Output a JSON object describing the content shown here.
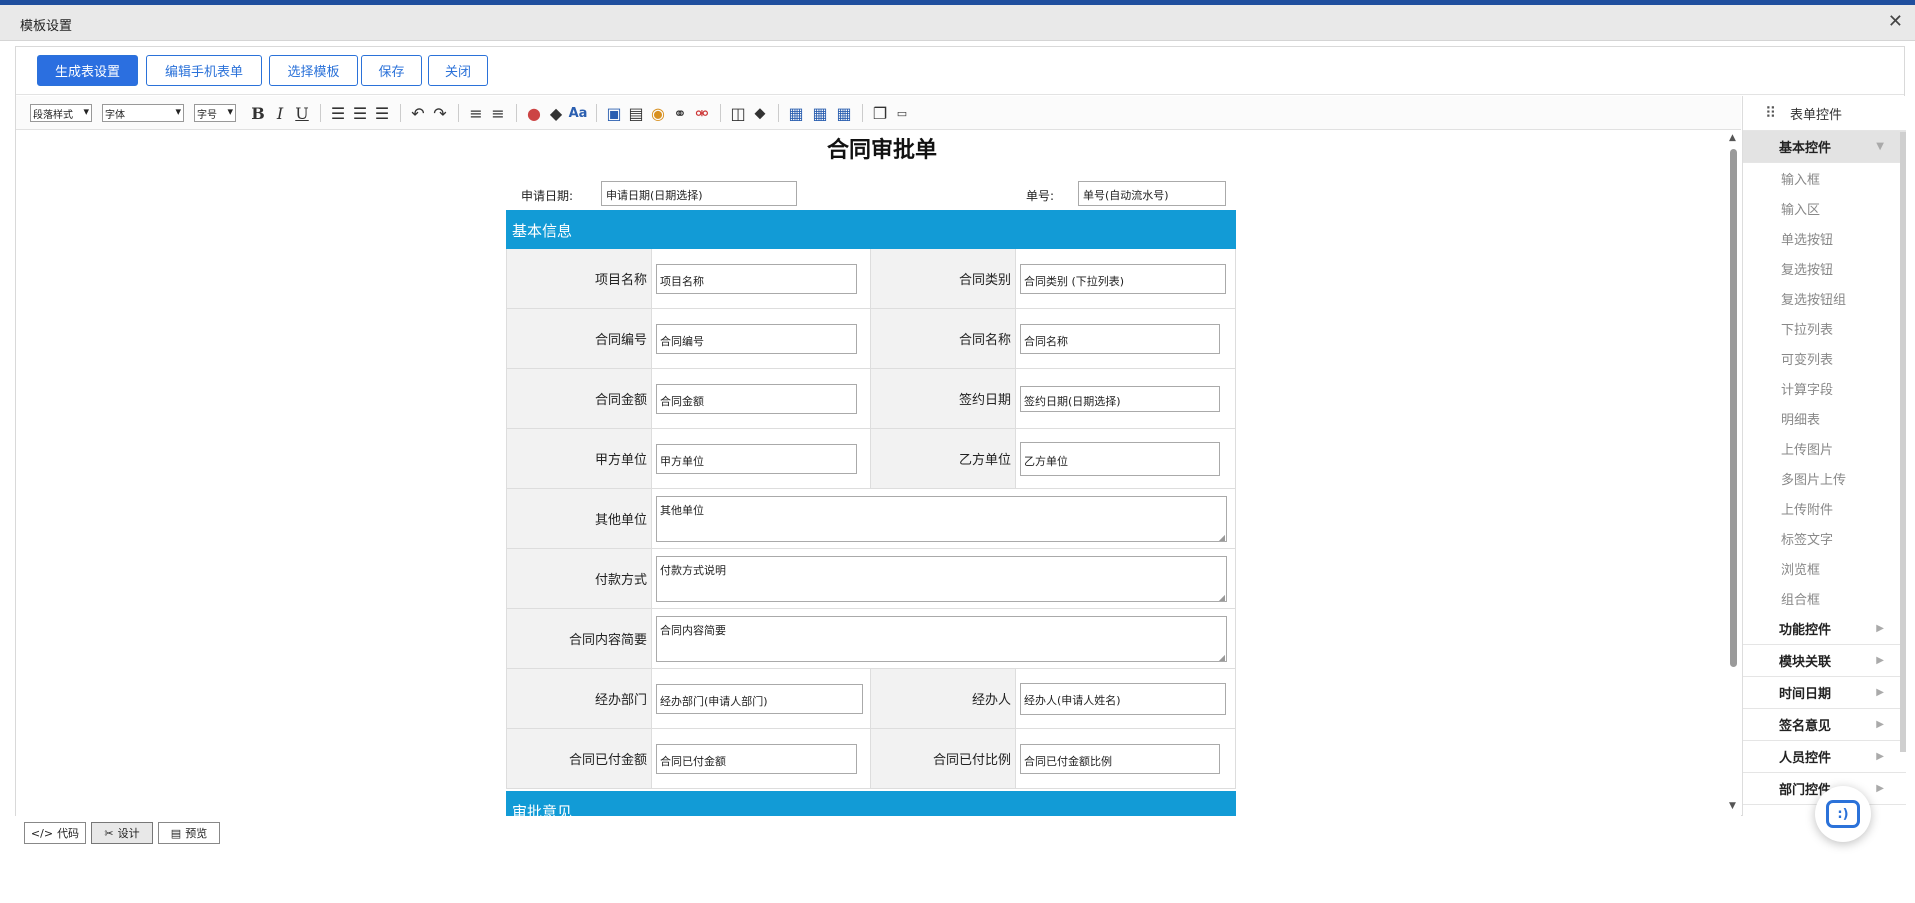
{
  "window": {
    "title": "模板设置",
    "close_glyph": "✕"
  },
  "buttons": {
    "generate": "生成表设置",
    "edit_mobile": "编辑手机表单",
    "select_template": "选择模板",
    "save": "保存",
    "close": "关闭"
  },
  "toolbar": {
    "paragraph_style": "段落样式",
    "font": "字体",
    "font_size": "字号"
  },
  "form": {
    "title": "合同审批单",
    "apply_date_label": "申请日期:",
    "apply_date_value": "申请日期(日期选择)",
    "number_label": "单号:",
    "number_value": "单号(自动流水号)",
    "section_basic": "基本信息",
    "section_approval": "审批意见",
    "rows": [
      {
        "l1": "项目名称",
        "v1": "项目名称",
        "l2": "合同类别",
        "v2": "合同类别 (下拉列表)"
      },
      {
        "l1": "合同编号",
        "v1": "合同编号",
        "l2": "合同名称",
        "v2": "合同名称"
      },
      {
        "l1": "合同金额",
        "v1": "合同金额",
        "l2": "签约日期",
        "v2": "签约日期(日期选择)"
      },
      {
        "l1": "甲方单位",
        "v1": "甲方单位",
        "l2": "乙方单位",
        "v2": "乙方单位"
      }
    ],
    "wide_rows": [
      {
        "label": "其他单位",
        "value": "其他单位"
      },
      {
        "label": "付款方式",
        "value": "付款方式说明"
      },
      {
        "label": "合同内容简要",
        "value": "合同内容简要"
      }
    ],
    "rows2": [
      {
        "l1": "经办部门",
        "v1": "经办部门(申请人部门)",
        "l2": "经办人",
        "v2": "经办人(申请人姓名)"
      },
      {
        "l1": "合同已付金额",
        "v1": "合同已付金额",
        "l2": "合同已付比例",
        "v2": "合同已付金额比例"
      }
    ]
  },
  "sidebar": {
    "header": "表单控件",
    "open_category": "基本控件",
    "items": [
      "输入框",
      "输入区",
      "单选按钮",
      "复选按钮",
      "复选按钮组",
      "下拉列表",
      "可变列表",
      "计算字段",
      "明细表",
      "上传图片",
      "多图片上传",
      "上传附件",
      "标签文字",
      "浏览框",
      "组合框"
    ],
    "categories": [
      "功能控件",
      "模块关联",
      "时间日期",
      "签名意见",
      "人员控件",
      "部门控件"
    ]
  },
  "mode_tabs": {
    "code": "代码",
    "design": "设计",
    "preview": "预览"
  }
}
